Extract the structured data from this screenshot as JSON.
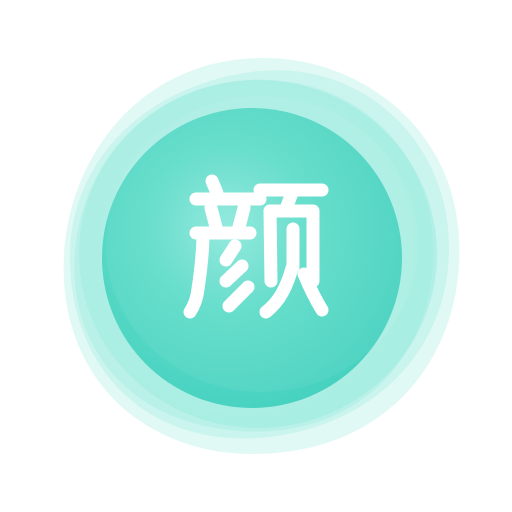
{
  "app_icon": {
    "logo_text": "颜",
    "colors": {
      "background": "#ffffff",
      "blob_core": "#4fd8c6",
      "blob_light": "#bdf1e9",
      "blob_mid": "#86e6d8",
      "glyph": "#ffffff"
    },
    "icon_name": "app-logo-icon"
  }
}
